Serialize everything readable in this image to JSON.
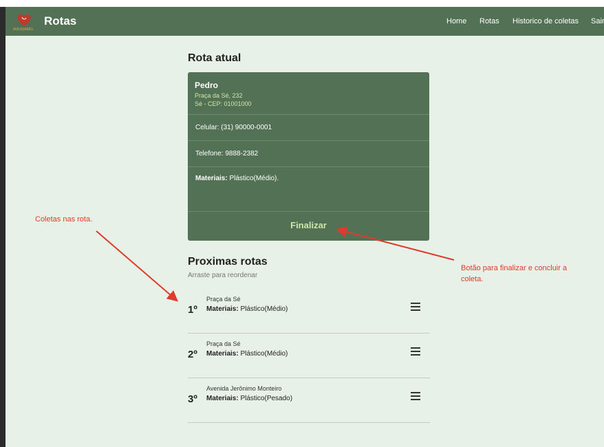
{
  "navbar": {
    "brand": "Rotas",
    "logo_text": "AVESSAMIG",
    "links": [
      "Home",
      "Rotas",
      "Historico de coletas",
      "Sair"
    ]
  },
  "current_route": {
    "title": "Rota atual",
    "name": "Pedro",
    "address": "Praça da Sé, 232",
    "district_cep": "Sé - CEP: 01001000",
    "cellphone": "Celular: (31) 90000-0001",
    "phone": "Telefone: 9888-2382",
    "materials_label": "Materiais:",
    "materials_value": "Plástico(Médio).",
    "finalize_button": "Finalizar"
  },
  "next_routes": {
    "title": "Proximas rotas",
    "subtitle": "Arraste para reordenar",
    "items": [
      {
        "order": "1º",
        "address": "Praça da Sé",
        "materials_label": "Materiais:",
        "materials_value": "Plástico(Médio)"
      },
      {
        "order": "2º",
        "address": "Praça da Sé",
        "materials_label": "Materiais:",
        "materials_value": "Plástico(Médio)"
      },
      {
        "order": "3º",
        "address": "Avenida Jerônimo Monteiro",
        "materials_label": "Materiais:",
        "materials_value": "Plástico(Pesado)"
      }
    ]
  },
  "annotations": {
    "left": "Coletas nas rota.",
    "right_line1": "Botão para finalizar e concluir a",
    "right_line2": "coleta."
  },
  "colors": {
    "primary": "#537255",
    "page_bg": "#e8f1e8",
    "accent_text": "#cfe6a8",
    "annotation": "#e03a2b"
  }
}
